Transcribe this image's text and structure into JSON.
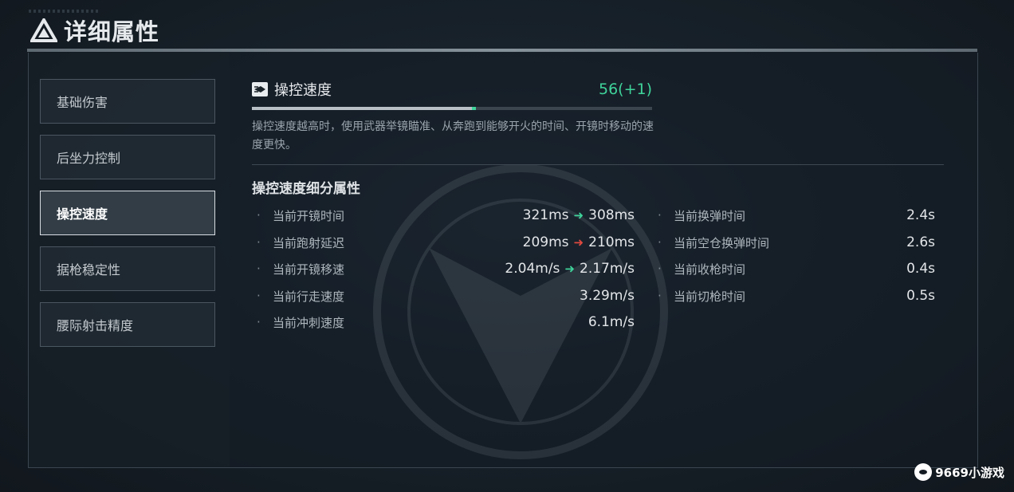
{
  "header": {
    "title": "详细属性"
  },
  "sidebar": {
    "items": [
      {
        "label": "基础伤害"
      },
      {
        "label": "后坐力控制"
      },
      {
        "label": "操控速度"
      },
      {
        "label": "据枪稳定性"
      },
      {
        "label": "腰际射击精度"
      }
    ],
    "active_index": 2
  },
  "stat": {
    "name": "操控速度",
    "value_text": "56(+1)",
    "value": 56,
    "bonus": 1,
    "bar_fraction": 0.56,
    "description": "操控速度越高时，使用武器举镜瞄准、从奔跑到能够开火的时间、开镜时移动的速度更快。"
  },
  "sub": {
    "title": "操控速度细分属性",
    "left": [
      {
        "label": "当前开镜时间",
        "from": "321ms",
        "to": "308ms",
        "trend": "up"
      },
      {
        "label": "当前跑射延迟",
        "from": "209ms",
        "to": "210ms",
        "trend": "down"
      },
      {
        "label": "当前开镜移速",
        "from": "2.04m/s",
        "to": "2.17m/s",
        "trend": "up"
      },
      {
        "label": "当前行走速度",
        "value": "3.29m/s"
      },
      {
        "label": "当前冲刺速度",
        "value": "6.1m/s"
      }
    ],
    "right": [
      {
        "label": "当前换弹时间",
        "value": "2.4s"
      },
      {
        "label": "当前空仓换弹时间",
        "value": "2.6s"
      },
      {
        "label": "当前收枪时间",
        "value": "0.4s"
      },
      {
        "label": "当前切枪时间",
        "value": "0.5s"
      }
    ]
  },
  "bullet": "·",
  "arrow": "➜",
  "watermark": {
    "text": "9669小游戏"
  },
  "colors": {
    "positive": "#3fd39a",
    "negative": "#e0493f",
    "accent": "#3fd39a"
  }
}
